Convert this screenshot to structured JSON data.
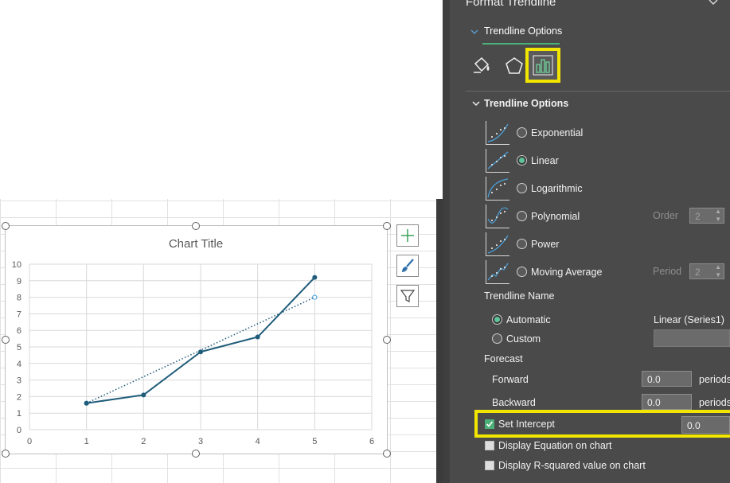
{
  "panel": {
    "header_title": "Format Trendline",
    "tab_label": "Trendline Options",
    "section_label": "Trendline Options",
    "types": [
      {
        "label": "Exponential",
        "selected": false
      },
      {
        "label": "Linear",
        "selected": true
      },
      {
        "label": "Logarithmic",
        "selected": false
      },
      {
        "label": "Polynomial",
        "selected": false
      },
      {
        "label": "Power",
        "selected": false
      },
      {
        "label": "Moving Average",
        "selected": false
      }
    ],
    "order_label": "Order",
    "order_value": "2",
    "period_label": "Period",
    "period_value": "2",
    "trendline_name_label": "Trendline Name",
    "automatic_label": "Automatic",
    "automatic_value": "Linear (Series1)",
    "custom_label": "Custom",
    "forecast_label": "Forecast",
    "forward_label": "Forward",
    "forward_value": "0.0",
    "backward_label": "Backward",
    "backward_value": "0.0",
    "periods_unit": "periods",
    "set_intercept_label": "Set Intercept",
    "set_intercept_checked": true,
    "intercept_value": "0.0",
    "display_equation_label": "Display Equation on chart",
    "display_rsquared_label": "Display R-squared value on chart"
  },
  "chart_data": {
    "type": "scatter",
    "title": "Chart Title",
    "xlim": [
      0,
      6
    ],
    "ylim": [
      0,
      10
    ],
    "x_ticks": [
      0,
      1,
      2,
      3,
      4,
      5,
      6
    ],
    "y_ticks": [
      0,
      1,
      2,
      3,
      4,
      5,
      6,
      7,
      8,
      9,
      10
    ],
    "grid": true,
    "series": [
      {
        "x": [
          1,
          2,
          3,
          4,
          5
        ],
        "y": [
          1.6,
          2.1,
          4.7,
          5.6,
          9.2
        ],
        "color": "#1f5c7a"
      }
    ],
    "trendline": {
      "type": "linear",
      "x": [
        1,
        5
      ],
      "y": [
        1.6,
        8.0
      ],
      "style": "dotted",
      "color": "#1f5c7a"
    }
  },
  "colors": {
    "panel_bg": "#4a4a4a",
    "accent_green": "#4caf78",
    "highlight_yellow": "#f2e600",
    "series_blue": "#1f5c7a"
  }
}
